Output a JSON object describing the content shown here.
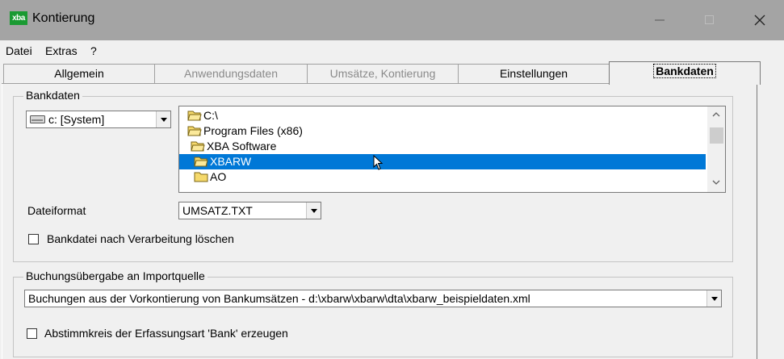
{
  "window": {
    "title": "Kontierung",
    "app_icon_text": "xba",
    "minimize_icon": "minimize-icon",
    "maximize_icon": "maximize-icon",
    "close_icon": "close-icon"
  },
  "menu": {
    "items": [
      "Datei",
      "Extras",
      "?"
    ]
  },
  "tabs": [
    {
      "label": "Allgemein",
      "state": "normal"
    },
    {
      "label": "Anwendungsdaten",
      "state": "disabled"
    },
    {
      "label": "Umsätze, Kontierung",
      "state": "disabled"
    },
    {
      "label": "Einstellungen",
      "state": "normal"
    },
    {
      "label": "Bankdaten",
      "state": "active"
    }
  ],
  "bankdaten": {
    "group_label": "Bankdaten",
    "drive_select": {
      "value": "c: [System]",
      "icon": "drive-icon"
    },
    "directories": [
      {
        "label": "C:\\",
        "icon": "open-folder-icon",
        "selected": false
      },
      {
        "label": "Program Files (x86)",
        "icon": "open-folder-icon",
        "selected": false
      },
      {
        "label": "XBA Software",
        "icon": "open-folder-icon",
        "selected": false
      },
      {
        "label": "XBARW",
        "icon": "open-folder-icon",
        "selected": true
      },
      {
        "label": "AO",
        "icon": "folder-icon",
        "selected": false
      }
    ],
    "dateiformat_label": "Dateiformat",
    "dateiformat_value": "UMSATZ.TXT",
    "checkbox_label": "Bankdatei nach Verarbeitung löschen",
    "checkbox_checked": false
  },
  "buchung": {
    "group_label": "Buchungsübergabe an Importquelle",
    "select_value": "Buchungen aus der Vorkontierung von Bankumsätzen - d:\\xbarw\\xbarw\\dta\\xbarw_beispieldaten.xml",
    "checkbox_label": "Abstimmkreis der Erfassungsart 'Bank' erzeugen",
    "checkbox_checked": false
  },
  "colors": {
    "titlebar": "#a4a4a4",
    "selection": "#0078d7",
    "window_bg": "#f0f0f0",
    "app_icon": "#1a9a32"
  }
}
